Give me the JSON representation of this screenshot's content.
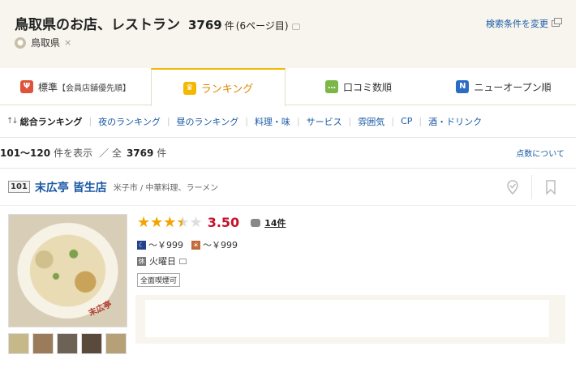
{
  "header": {
    "title": "鳥取県のお店、レストラン",
    "count": "3769",
    "count_unit": "件",
    "pages": "(6ページ目)",
    "search_change": "検索条件を変更",
    "area_tag": "鳥取県",
    "area_remove": "×"
  },
  "tabs": [
    {
      "label": "標準",
      "sub": "【会員店舗優先順】",
      "icon": "🍴",
      "color": "#e0533b"
    },
    {
      "label": "ランキング",
      "icon": "♛",
      "color": "#f5b800"
    },
    {
      "label": "口コミ数順",
      "icon": "…",
      "color": "#7ab648"
    },
    {
      "label": "ニューオープン順",
      "icon": "N",
      "color": "#2a6cc4"
    }
  ],
  "subnav": {
    "current": "総合ランキング",
    "items": [
      "夜のランキング",
      "昼のランキング",
      "料理・味",
      "サービス",
      "雰囲気",
      "CP",
      "酒・ドリンク"
    ]
  },
  "results": {
    "range": "101～120",
    "range_suffix": "件を表示",
    "sep": "／ 全",
    "total": "3769",
    "unit": "件",
    "about": "点数について"
  },
  "restaurant": {
    "rank": "101",
    "name": "末広亭 皆生店",
    "area": "米子市 / 中華料理、ラーメン",
    "stars": "★★★★★",
    "rating": 3.5,
    "rating_text": "3.50",
    "reviews": "14件",
    "budget_dinner": "～￥999",
    "budget_lunch": "～￥999",
    "holiday": "火曜日",
    "holiday_icon": "休",
    "smoking": "全面喫煙可",
    "photo_text": "末広亭"
  },
  "colors": {
    "accent": "#f5b800",
    "link": "#1a5aa5",
    "score": "#c8102e"
  }
}
